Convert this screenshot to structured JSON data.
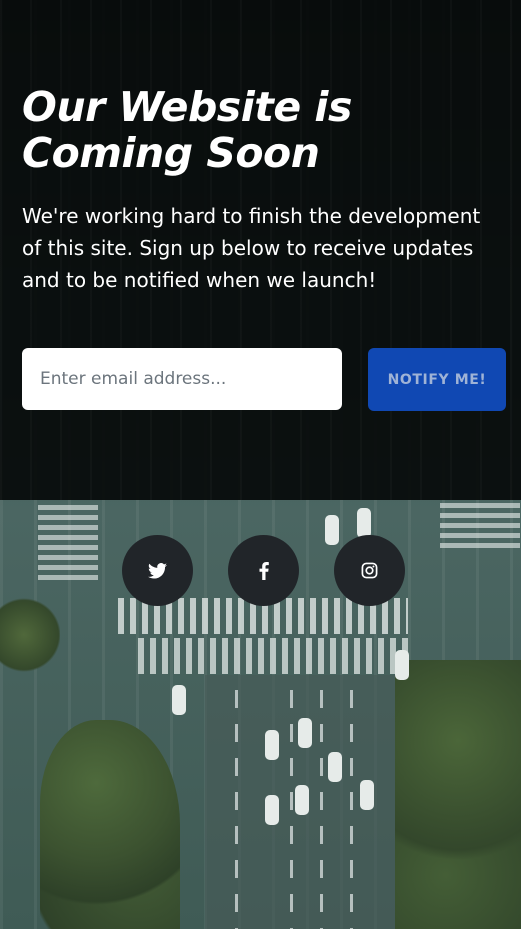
{
  "masthead": {
    "headline": "Our Website is Coming Soon",
    "lead": "We're working hard to finish the development of this site. Sign up below to receive updates and to be notified when we launch!"
  },
  "signup": {
    "email_placeholder": "Enter email address...",
    "email_value": "",
    "button_label": "Notify Me!"
  },
  "social": {
    "icons": [
      "twitter-icon",
      "facebook-icon",
      "instagram-icon"
    ]
  },
  "colors": {
    "button_bg": "#1048b3",
    "social_bg": "#212529",
    "overlay": "#060a0a"
  }
}
